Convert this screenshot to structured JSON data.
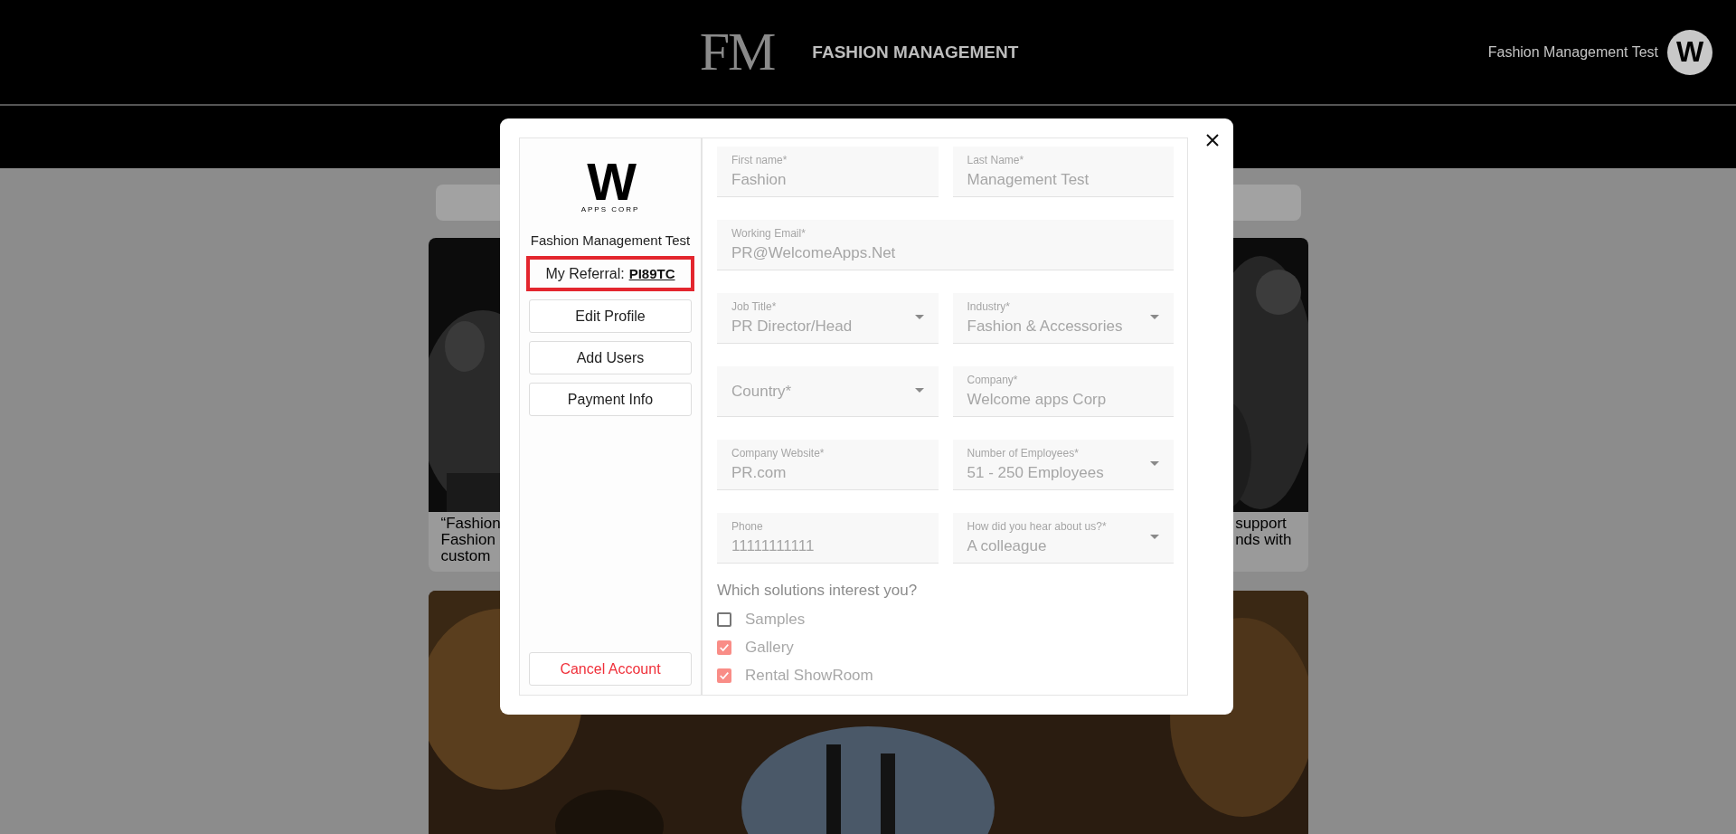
{
  "header": {
    "logo": "FM",
    "title": "FASHION MANAGEMENT",
    "user_name": "Fashion Management Test",
    "avatar_letter": "W"
  },
  "cards": [
    {
      "kind": "picture",
      "text_left": [
        "“Fashion",
        "Fashion",
        "custom"
      ],
      "text_right": [
        "support",
        "nds with"
      ]
    },
    {
      "kind": "picture"
    }
  ],
  "modal": {
    "logo": {
      "letter": "W",
      "tagline": "APPS CORP"
    },
    "profile_name": "Fashion Management Test",
    "referral": {
      "label": "My Referral:",
      "code": "PI89TC",
      "highlighted": true
    },
    "buttons": [
      {
        "label": "Edit Profile"
      },
      {
        "label": "Add Users"
      },
      {
        "label": "Payment Info"
      }
    ],
    "cancel_button": {
      "label": "Cancel Account",
      "kind": "danger"
    },
    "field_rows": [
      [
        {
          "label": "First name*",
          "value": "Fashion",
          "kind": "text"
        },
        {
          "label": "Last Name*",
          "value": "Management Test",
          "kind": "text"
        }
      ],
      [
        {
          "label": "Working Email*",
          "value": "PR@WelcomeApps.Net",
          "kind": "text"
        }
      ],
      [
        {
          "label": "Job Title*",
          "value": "PR Director/Head",
          "kind": "select"
        },
        {
          "label": "Industry*",
          "value": "Fashion & Accessories",
          "kind": "select"
        }
      ],
      [
        {
          "label": "Country*",
          "kind": "select"
        },
        {
          "label": "Company*",
          "value": "Welcome apps Corp",
          "kind": "text"
        }
      ],
      [
        {
          "label": "Company Website*",
          "value": "PR.com",
          "kind": "text"
        },
        {
          "label": "Number of Employees*",
          "value": "51 - 250 Employees",
          "kind": "select"
        }
      ],
      [
        {
          "label": "Phone",
          "value": "11111111111",
          "kind": "text"
        },
        {
          "label": "How did you hear about us?*",
          "value": "A colleague",
          "kind": "select"
        }
      ]
    ],
    "solutions": {
      "question": "Which solutions interest you?",
      "options": [
        {
          "label": "Samples",
          "checked": false
        },
        {
          "label": "Gallery",
          "checked": true
        },
        {
          "label": "Rental ShowRoom",
          "checked": true
        }
      ]
    }
  }
}
